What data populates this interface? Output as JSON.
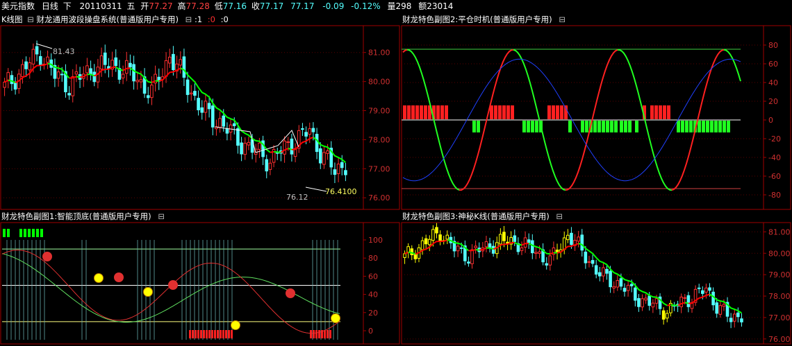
{
  "quote_bar": {
    "name": "美元指数",
    "period": "日线",
    "direction": "下",
    "date": "20110311",
    "weekday": "五",
    "open_label": "开",
    "open": "77.27",
    "high_label": "高",
    "high": "77.28",
    "low_label": "低",
    "low": "77.16",
    "close_label": "收",
    "close": "77.17",
    "last": "77.17",
    "change": "-0.09",
    "change_pct": "-0.12%",
    "volume_label": "量",
    "volume": "298",
    "amount_label": "额",
    "amount": "23014"
  },
  "panels": {
    "main": {
      "title": "K线图",
      "toggle": "⊟",
      "indicator": "财龙通用波段操盘系统(普通版用户专用)",
      "params_toggle": "⊟",
      "params": [
        ":1",
        ":0",
        ":0"
      ],
      "price_labels": [
        "81.43",
        "76.12",
        "76.4100"
      ],
      "y_ticks": [
        "81.00",
        "80.00",
        "79.00",
        "78.00",
        "77.00",
        "76.00"
      ]
    },
    "sub1": {
      "title": "财龙特色副图1:智能顶底(普通版用户专用)",
      "toggle": "⊟",
      "y_ticks": [
        "100",
        "80",
        "60",
        "40",
        "20",
        "0"
      ]
    },
    "sub2": {
      "title": "财龙特色副图2:平仓时机(普通版用户专用)",
      "toggle": "⊟",
      "y_ticks": [
        "80",
        "60",
        "40",
        "20",
        "0",
        "-20",
        "-40",
        "-60",
        "-80"
      ]
    },
    "sub3": {
      "title": "财龙特色副图3:神秘K线(普通版用户专用)",
      "toggle": "⊟",
      "y_ticks": [
        "81.00",
        "80.00",
        "79.00",
        "78.00",
        "77.00",
        "76.00"
      ]
    }
  },
  "colors": {
    "up": "#ff3030",
    "down": "#54ffff",
    "bull_line": "#ff0000",
    "bear_line": "#00ff00",
    "axis_red": "#a00000",
    "grid_red": "#5a0000",
    "yellow": "#ffff00",
    "blue": "#3030ff"
  }
}
